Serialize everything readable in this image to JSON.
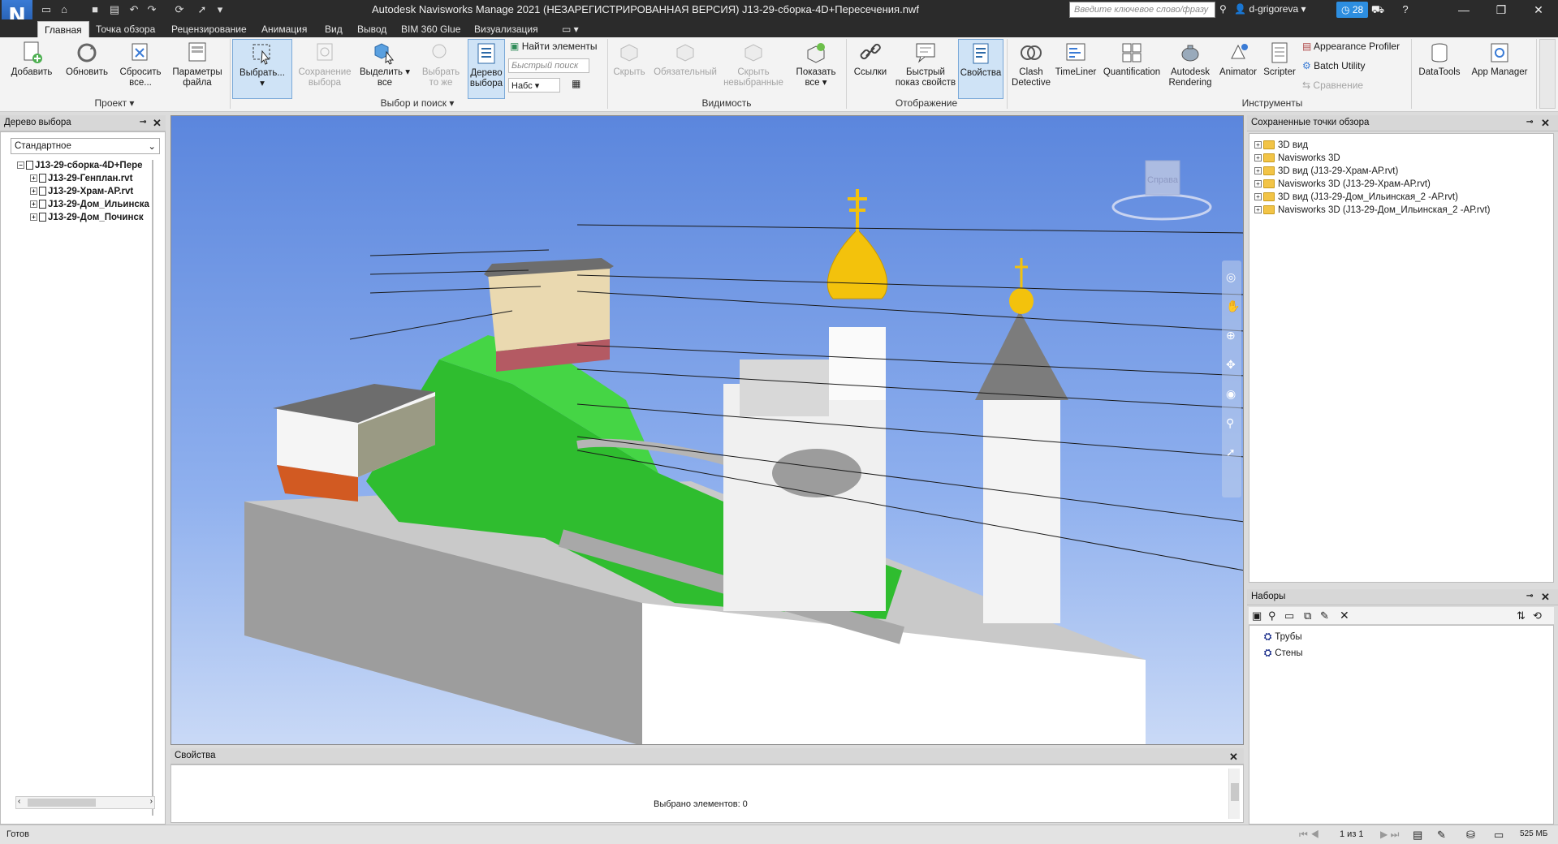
{
  "window": {
    "app_logo": "N",
    "title": "Autodesk Navisworks Manage 2021 (НЕЗАРЕГИСТРИРОВАННАЯ ВЕРСИЯ)    J13-29-сборка-4D+Пересечения.nwf",
    "search_placeholder": "Введите ключевое слово/фразу",
    "username": "d-grigoreva",
    "notifications_count": "28"
  },
  "tabs": [
    "Главная",
    "Точка обзора",
    "Рецензирование",
    "Анимация",
    "Вид",
    "Вывод",
    "BIM 360 Glue",
    "Визуализация"
  ],
  "ribbon": {
    "project": {
      "label": "Проект",
      "add": "Добавить",
      "refresh": "Обновить",
      "reset_line1": "Сбросить",
      "reset_line2": "все...",
      "params_line1": "Параметры",
      "params_line2": "файла"
    },
    "select": {
      "label": "Выбор и поиск",
      "select": "Выбрать...",
      "save_sel_line1": "Сохранение",
      "save_sel_line2": "выбора",
      "select_all_line1": "Выделить",
      "select_all_line2": "все",
      "select_same_line1": "Выбрать",
      "select_same_line2": "то же",
      "tree_line1": "Дерево",
      "tree_line2": "выбора",
      "find_items": "Найти элементы",
      "quick_find_placeholder": "Быстрый поиск",
      "sets_value": "Набс"
    },
    "visibility": {
      "label": "Видимость",
      "hide": "Скрыть",
      "required": "Обязательный",
      "hide_unsel_line1": "Скрыть",
      "hide_unsel_line2": "невыбранные",
      "show_all_line1": "Показать",
      "show_all_line2": "все"
    },
    "display": {
      "label": "Отображение",
      "links": "Ссылки",
      "quick_props_line1": "Быстрый",
      "quick_props_line2": "показ свойств",
      "properties": "Свойства"
    },
    "tools": {
      "label": "Инструменты",
      "clash_line1": "Clash",
      "clash_line2": "Detective",
      "timeliner": "TimeLiner",
      "quantification": "Quantification",
      "rendering_line1": "Autodesk",
      "rendering_line2": "Rendering",
      "animator": "Animator",
      "scripter": "Scripter",
      "appearance_profiler": "Appearance Profiler",
      "batch_utility": "Batch Utility",
      "compare": "Сравнение"
    },
    "datatools": "DataTools",
    "app_manager": "App Manager"
  },
  "selection_tree": {
    "title": "Дерево выбора",
    "dropdown_value": "Стандартное",
    "root": "J13-29-сборка-4D+Пере",
    "children": [
      "J13-29-Генплан.rvt",
      "J13-29-Храм-АР.rvt",
      "J13-29-Дом_Ильинска",
      "J13-29-Дом_Починск"
    ]
  },
  "viewcube_label": "Справа",
  "saved_viewpoints": {
    "title": "Сохраненные точки обзора",
    "items": [
      "3D вид",
      "Navisworks 3D",
      "3D вид (J13-29-Храм-АР.rvt)",
      "Navisworks 3D (J13-29-Храм-АР.rvt)",
      "3D вид (J13-29-Дом_Ильинская_2 -АР.rvt)",
      "Navisworks 3D (J13-29-Дом_Ильинская_2 -АР.rvt)"
    ]
  },
  "sets": {
    "title": "Наборы",
    "items": [
      "Трубы",
      "Стены"
    ]
  },
  "properties": {
    "title": "Свойства",
    "selected_text": "Выбрано элементов: 0"
  },
  "status": {
    "ready": "Готов",
    "page": "1 из 1",
    "memory": "525 МБ"
  }
}
